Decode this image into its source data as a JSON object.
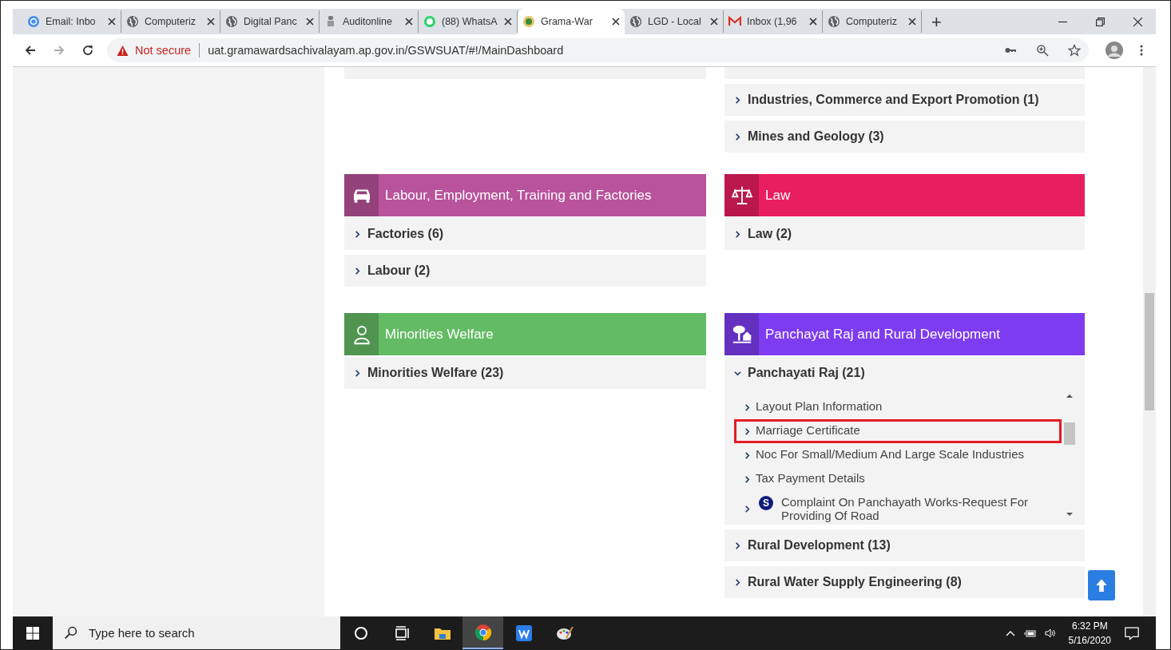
{
  "browser": {
    "tabs": [
      {
        "title": "Email: Inbo",
        "kind": "email",
        "selected": false
      },
      {
        "title": "Computeriz",
        "kind": "globe",
        "selected": false
      },
      {
        "title": "Digital Panc",
        "kind": "globe",
        "selected": false
      },
      {
        "title": "Auditonline",
        "kind": "emblem",
        "selected": false
      },
      {
        "title": "(88) WhatsA",
        "kind": "chat",
        "selected": false
      },
      {
        "title": "Grama-War",
        "kind": "seal",
        "selected": true
      },
      {
        "title": "LGD - Local",
        "kind": "globe",
        "selected": false
      },
      {
        "title": "Inbox (1,96",
        "kind": "mail",
        "selected": false
      },
      {
        "title": "Computeriz",
        "kind": "globe",
        "selected": false
      }
    ],
    "new_tab": "+",
    "security": "Not secure",
    "url": "uat.gramawardsachivalayam.ap.gov.in/GSWSUAT/#!/MainDashboard"
  },
  "dashboard": {
    "top_items_right": [
      {
        "label": "Industries, Commerce and Export Promotion (1)"
      },
      {
        "label": "Mines and Geology (3)"
      }
    ],
    "categories": [
      {
        "title": "Labour, Employment, Training and Factories",
        "kind": "car",
        "color": "#b9539b",
        "items": [
          {
            "label": "Factories (6)",
            "expanded": false
          },
          {
            "label": "Labour (2)",
            "expanded": false
          }
        ]
      },
      {
        "title": "Law",
        "kind": "scales",
        "color": "#e91e5f",
        "items": [
          {
            "label": "Law (2)",
            "expanded": false
          }
        ]
      },
      {
        "title": "Minorities Welfare",
        "kind": "person",
        "color": "#63bb64",
        "items": [
          {
            "label": "Minorities Welfare (23)",
            "expanded": false
          }
        ]
      },
      {
        "title": "Panchayat Raj and Rural Development",
        "kind": "tree",
        "color": "#7d3cf0",
        "items": [
          {
            "label": "Panchayati Raj (21)",
            "expanded": true,
            "services": [
              {
                "label": "Layout Plan Information",
                "highlighted": false,
                "badge": false
              },
              {
                "label": "Marriage Certificate",
                "highlighted": true,
                "badge": false
              },
              {
                "label": "Noc For Small/Medium And Large Scale Industries",
                "highlighted": false,
                "badge": false
              },
              {
                "label": "Tax Payment Details",
                "highlighted": false,
                "badge": false
              },
              {
                "label": "Complaint On Panchayath Works-Request For Providing Of Road",
                "highlighted": false,
                "badge": true,
                "badge_text": "S"
              }
            ]
          },
          {
            "label": "Rural Development (13)",
            "expanded": false
          },
          {
            "label": "Rural Water Supply Engineering (8)",
            "expanded": false
          }
        ]
      }
    ]
  },
  "taskbar": {
    "search": {
      "placeholder": "Type here to search"
    },
    "apps": [
      {
        "kind": "circle",
        "selected": false
      },
      {
        "kind": "taskview",
        "selected": false
      },
      {
        "kind": "folder",
        "selected": false
      },
      {
        "kind": "chrome",
        "selected": true
      },
      {
        "kind": "wps",
        "selected": false
      },
      {
        "kind": "paint",
        "selected": false
      }
    ],
    "time": "6:32 PM",
    "date": "5/16/2020"
  }
}
